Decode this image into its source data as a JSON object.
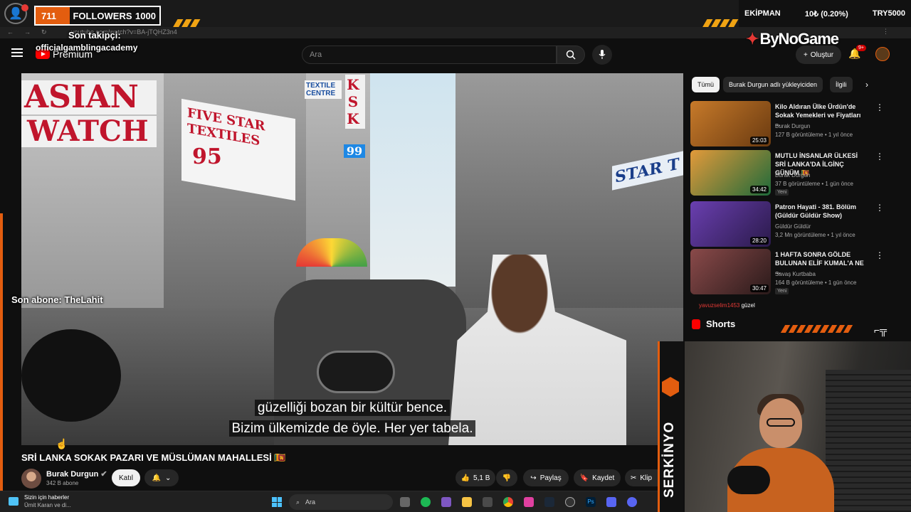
{
  "overlay": {
    "followers_count": "711",
    "followers_label": "FOLLOWERS",
    "followers_goal": "1000",
    "last_follower_label": "Son takipçi:",
    "last_follower_name": "officialgamblingacademy",
    "last_sub_label": "Son abone: TheLahit",
    "ticker_left": "EKİPMAN",
    "ticker_mid": "10₺ (0.20%)",
    "ticker_right": "TRY5000",
    "brand": "ByNoGame",
    "streamer_name": "SERKİNYO"
  },
  "browser": {
    "url": "youtube.com/watch?v=BA-jTQHZ3n4"
  },
  "yt_header": {
    "logo_text": "Premium",
    "search_placeholder": "Ara",
    "create_label": "Oluştur",
    "notif_badge": "9+"
  },
  "video": {
    "subtitle_line1": "güzelliği bozan bir kültür bence.",
    "subtitle_line2": "Bizim ülkemizde de öyle. Her yer tabela.",
    "signs": {
      "sign1": "ASIAN",
      "sign2": "WATCH",
      "sign3": "FIVE STAR TEXTILES",
      "sign4": "95",
      "sign5": "TEXTILE CENTRE",
      "sign6": "KSK",
      "sign7": "99",
      "sign8": "STAR T"
    },
    "title": "SRİ LANKA SOKAK PAZARI VE MÜSLÜMAN MAHALLESİ 🇱🇰",
    "channel_name": "Burak Durgun",
    "channel_subs": "342 B abone",
    "join_label": "Katıl",
    "likes": "5,1 B",
    "share_label": "Paylaş",
    "save_label": "Kaydet",
    "clip_label": "Klip"
  },
  "sidebar": {
    "chips": [
      "Tümü",
      "Burak Durgun adlı yükleyiciden",
      "İlgili"
    ],
    "recommendations": [
      {
        "title": "Kilo Aldıran Ülke Ürdün'de Sokak Yemekleri ve Fiyatları ...",
        "channel": "Burak Durgun",
        "meta": "127 B görüntüleme • 1 yıl önce",
        "duration": "25:03",
        "badge": "",
        "thumb_color": "#c77a2a"
      },
      {
        "title": "MUTLU İNSANLAR ÜLKESİ SRİ LANKA'DA İLGİNÇ GÜNÜM 🇱🇰",
        "channel": "Burak Durgun",
        "meta": "37 B görüntüleme • 1 gün önce",
        "duration": "34:42",
        "badge": "Yeni",
        "thumb_color": "#d8892a"
      },
      {
        "title": "Patron Hayati - 381. Bölüm (Güldür Güldür Show)",
        "channel": "Güldür Güldür",
        "meta": "3,2 Mn görüntüleme • 1 yıl önce",
        "duration": "28:20",
        "badge": "",
        "thumb_color": "#4a2f7a"
      },
      {
        "title": "1 HAFTA SONRA GÖLDE BULUNAN ELİF KUMAL'A NE ...",
        "channel": "Savaş Kurtbaba",
        "meta": "164 B görüntüleme • 1 gün önce",
        "duration": "30:47",
        "badge": "Yeni",
        "thumb_color": "#5a3030"
      }
    ],
    "chat_user": "yavuzselim1453",
    "chat_msg": "güzel",
    "shorts_label": "Shorts"
  },
  "taskbar": {
    "news_line1": "Sizin için haberler",
    "news_line2": "Ümit Karan ve di...",
    "search_label": "Ara"
  }
}
